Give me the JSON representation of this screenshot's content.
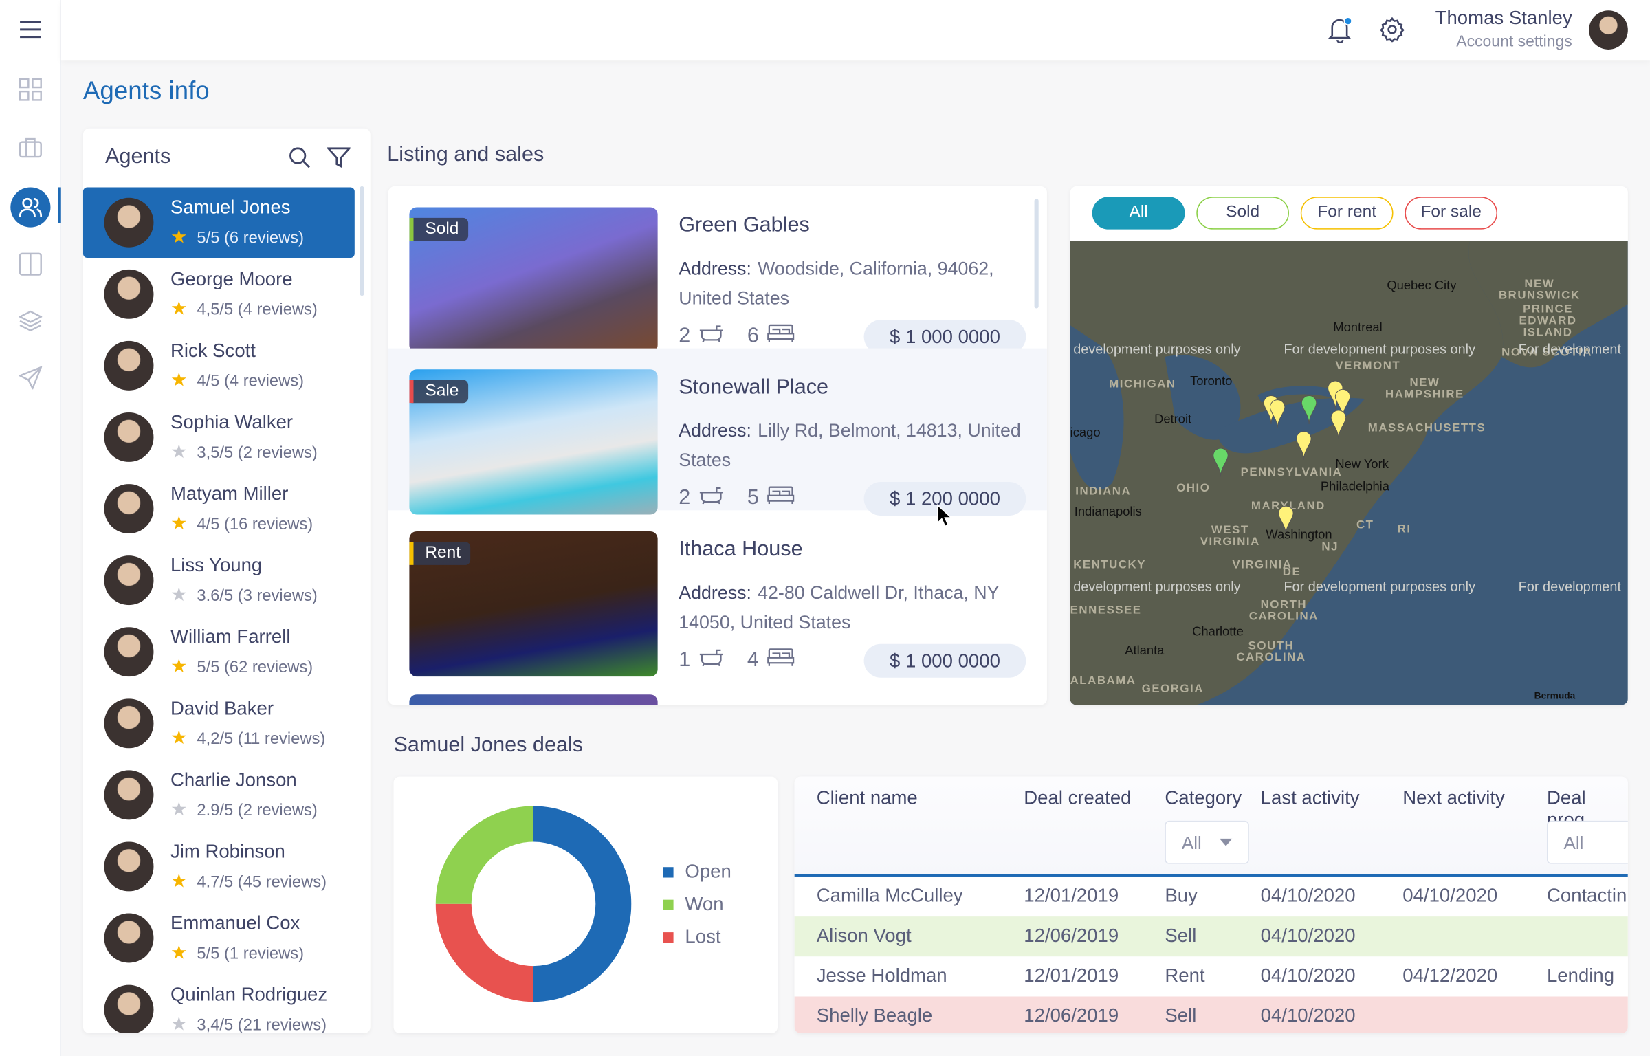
{
  "header": {
    "user_name": "Thomas Stanley",
    "user_sub": "Account settings"
  },
  "page_title": "Agents info",
  "agents_panel": {
    "title": "Agents",
    "items": [
      {
        "name": "Samuel Jones",
        "rating": "5/5 (6 reviews)",
        "star": "full",
        "active": true
      },
      {
        "name": "George Moore",
        "rating": "4,5/5 (4 reviews)",
        "star": "full"
      },
      {
        "name": "Rick Scott",
        "rating": "4/5 (4 reviews)",
        "star": "full"
      },
      {
        "name": "Sophia Walker",
        "rating": "3,5/5 (2 reviews)",
        "star": "empty"
      },
      {
        "name": "Matyam Miller",
        "rating": "4/5 (16 reviews)",
        "star": "full"
      },
      {
        "name": "Liss Young",
        "rating": "3.6/5 (3 reviews)",
        "star": "empty"
      },
      {
        "name": "William Farrell",
        "rating": "5/5 (62 reviews)",
        "star": "full"
      },
      {
        "name": "David Baker",
        "rating": "4,2/5 (11 reviews)",
        "star": "full"
      },
      {
        "name": "Charlie Jonson",
        "rating": "2.9/5 (2 reviews)",
        "star": "empty"
      },
      {
        "name": "Jim Robinson",
        "rating": "4.7/5 (45 reviews)",
        "star": "full"
      },
      {
        "name": "Emmanuel Cox",
        "rating": "5/5 (1 reviews)",
        "star": "full"
      },
      {
        "name": "Quinlan Rodriguez",
        "rating": "3,4/5 (21 reviews)",
        "star": "empty"
      }
    ]
  },
  "listing": {
    "title": "Listing and sales",
    "address_label": "Address:",
    "items": [
      {
        "tag": "Sold",
        "tag_color": "#8cc63f",
        "title": "Green Gables",
        "address": "Woodside, California, 94062, United States",
        "baths": "2",
        "beds": "6",
        "price": "$ 1 000 0000"
      },
      {
        "tag": "Sale",
        "tag_color": "#e84c4c",
        "title": "Stonewall Place",
        "address": "Lilly Rd, Belmont, 14813, United States",
        "baths": "2",
        "beds": "5",
        "price": "$ 1 200 0000"
      },
      {
        "tag": "Rent",
        "tag_color": "#f5c000",
        "title": "Ithaca House",
        "address": "42-80 Caldwell Dr, Ithaca, NY 14050, United States",
        "baths": "1",
        "beds": "4",
        "price": "$ 1 000 0000"
      }
    ]
  },
  "map": {
    "filters": [
      {
        "label": "All",
        "color": "#1a9ab8",
        "active": true
      },
      {
        "label": "Sold",
        "color": "#8cd048"
      },
      {
        "label": "For rent",
        "color": "#f5c000"
      },
      {
        "label": "For sale",
        "color": "#e84c4c"
      }
    ],
    "watermark": "For development purposes only",
    "watermark_cut": "development purposes only",
    "watermark_edge": "For development",
    "regions": [
      "MICHIGAN",
      "VERMONT",
      "NEW HAMPSHIRE",
      "MASSACHUSETTS",
      "PENNSYLVANIA",
      "OHIO",
      "INDIANA",
      "WEST VIRGINIA",
      "KENTUCKY",
      "VIRGINIA",
      "NORTH CAROLINA",
      "SOUTH CAROLINA",
      "ENNESSEE",
      "ALABAMA",
      "GEORGIA",
      "NEW BRUNSWICK",
      "PRINCE EDWARD ISLAND",
      "NOVA SCOTIA",
      "CT",
      "RI",
      "NJ",
      "DE",
      "MARYLAND"
    ],
    "cities": [
      "Quebec City",
      "Montreal",
      "Toronto",
      "Detroit",
      "icago",
      "Indianapolis",
      "New York",
      "Philadelphia",
      "Washington",
      "Charlotte",
      "Atlanta",
      "Bermuda"
    ]
  },
  "deals": {
    "title": "Samuel Jones deals",
    "chart_data": {
      "type": "pie",
      "variant": "donut",
      "categories": [
        "Open",
        "Won",
        "Lost"
      ],
      "values": [
        50,
        25,
        25
      ],
      "colors": [
        "#1e6ab5",
        "#8fd14f",
        "#e8524f"
      ]
    },
    "columns": [
      "Client name",
      "Deal created",
      "Category",
      "Last activity",
      "Next activity",
      "Deal prog"
    ],
    "category_filter": "All",
    "progress_filter": "All",
    "rows": [
      {
        "client": "Camilla McCulley",
        "created": "12/01/2019",
        "category": "Buy",
        "last": "04/10/2020",
        "next": "04/10/2020",
        "progress": "Contactin",
        "status": "none"
      },
      {
        "client": "Alison Vogt",
        "created": "12/06/2019",
        "category": "Sell",
        "last": "04/10/2020",
        "next": "",
        "progress": "",
        "status": "won"
      },
      {
        "client": "Jesse Holdman",
        "created": "12/01/2019",
        "category": "Rent",
        "last": "04/10/2020",
        "next": "04/12/2020",
        "progress": "Lending",
        "status": "none"
      },
      {
        "client": "Shelly Beagle",
        "created": "12/06/2019",
        "category": "Sell",
        "last": "04/10/2020",
        "next": "",
        "progress": "",
        "status": "lost"
      }
    ]
  }
}
